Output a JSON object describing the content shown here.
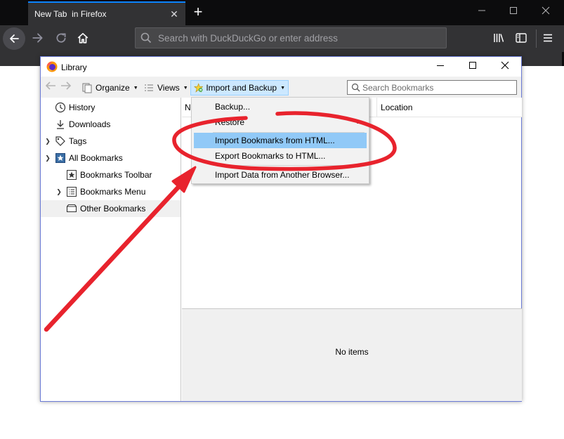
{
  "browser": {
    "tab_title": "New Tab  in Firefox",
    "url_placeholder": "Search with DuckDuckGo or enter address"
  },
  "library": {
    "title": "Library",
    "toolbar": {
      "organize": "Organize",
      "views": "Views",
      "import_backup": "Import and Backup",
      "search_placeholder": "Search Bookmarks"
    },
    "sidebar": {
      "items": [
        {
          "label": "History",
          "icon": "clock-icon"
        },
        {
          "label": "Downloads",
          "icon": "download-icon"
        },
        {
          "label": "Tags",
          "icon": "tag-icon"
        },
        {
          "label": "All Bookmarks",
          "icon": "bookmark-star-icon"
        },
        {
          "label": "Bookmarks Toolbar",
          "icon": "star-icon"
        },
        {
          "label": "Bookmarks Menu",
          "icon": "list-icon"
        },
        {
          "label": "Other Bookmarks",
          "icon": "folder-icon"
        }
      ]
    },
    "columns": {
      "name_partial": "N",
      "location": "Location"
    },
    "details": {
      "empty_text": "No items"
    }
  },
  "menu": {
    "items": [
      {
        "label": "Backup..."
      },
      {
        "label": "Restore"
      },
      {
        "label": "Import Bookmarks from HTML..."
      },
      {
        "label": "Export Bookmarks to HTML..."
      },
      {
        "label": "Import Data from Another Browser..."
      }
    ]
  },
  "colors": {
    "annotation": "#e8232d",
    "menu_highlight": "#91c9f7",
    "tab_accent": "#0a84ff"
  }
}
